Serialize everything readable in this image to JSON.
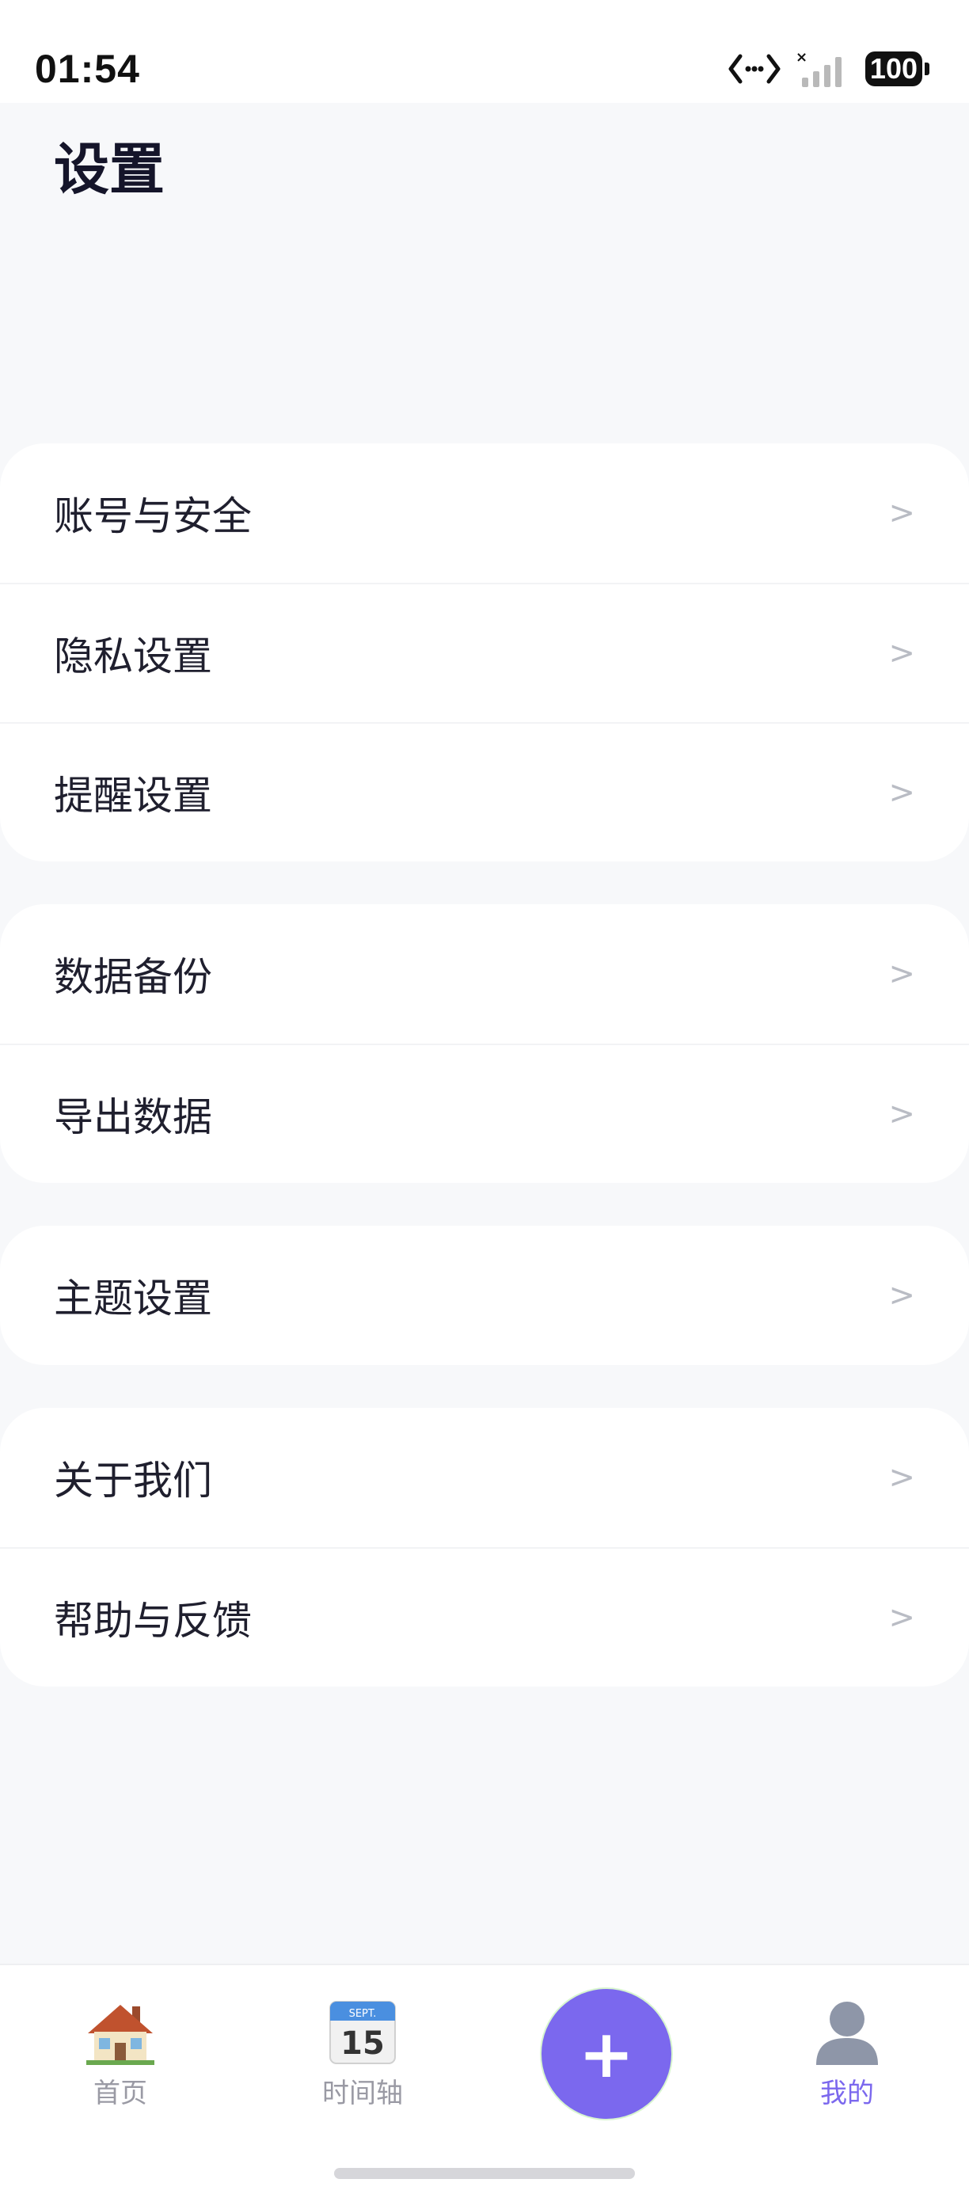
{
  "status_bar": {
    "time": "01:54",
    "battery": "100"
  },
  "page": {
    "title": "设置"
  },
  "groups": [
    {
      "items": [
        {
          "label": "账号与安全",
          "chevron": ">"
        },
        {
          "label": "隐私设置",
          "chevron": ">"
        },
        {
          "label": "提醒设置",
          "chevron": ">"
        }
      ]
    },
    {
      "items": [
        {
          "label": "数据备份",
          "chevron": ">"
        },
        {
          "label": "导出数据",
          "chevron": ">"
        }
      ]
    },
    {
      "items": [
        {
          "label": "主题设置",
          "chevron": ">"
        }
      ]
    },
    {
      "items": [
        {
          "label": "关于我们",
          "chevron": ">"
        },
        {
          "label": "帮助与反馈",
          "chevron": ">"
        }
      ]
    }
  ],
  "bottom_nav": {
    "items": [
      {
        "label": "首页",
        "icon": "house-icon"
      },
      {
        "label": "时间轴",
        "icon": "calendar-icon",
        "calendar_month": "SEPT.",
        "calendar_day": "15"
      },
      {
        "label": "",
        "icon": "plus-icon",
        "symbol": "+"
      },
      {
        "label": "我的",
        "icon": "user-icon",
        "active": true
      }
    ]
  },
  "colors": {
    "accent": "#7b68ee",
    "background": "#f7f8fa",
    "card": "#ffffff",
    "chevron": "#b9bcc4"
  }
}
